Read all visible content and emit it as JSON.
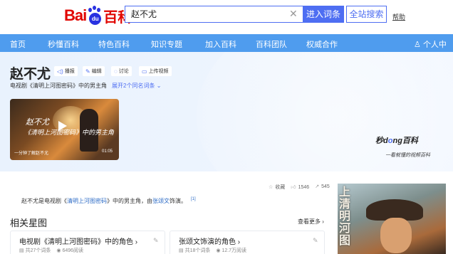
{
  "header": {
    "logo_bai": "Bai",
    "logo_du": "du",
    "logo_baike": "百科",
    "search_value": "赵不尤",
    "clear_icon": "close-icon",
    "enter_button": "进入词条",
    "site_search_button": "全站搜索",
    "help_link": "帮助",
    "accent_color": "#4e6ef2"
  },
  "nav": {
    "items": [
      "首页",
      "秒懂百科",
      "特色百科",
      "知识专题",
      "加入百科",
      "百科团队",
      "权威合作"
    ],
    "user_center": "个人中心",
    "color": "#4f9cee"
  },
  "entry": {
    "title": "赵不尤",
    "actions": [
      {
        "icon": "broadcast-icon",
        "label": "播报"
      },
      {
        "icon": "edit-icon",
        "label": "编辑"
      },
      {
        "icon": "comment-icon",
        "label": "讨论"
      },
      {
        "icon": "upload-video-icon",
        "label": "上传视频"
      }
    ],
    "subtitle": "电视剧《清明上河图密码》中的男主角",
    "more_entries": "展开2个同名词条"
  },
  "video": {
    "name": "赵不尤",
    "caption": "《清明上河图密码》中的男主角",
    "footer": "一分钟了解赵不尤",
    "duration": "01:05"
  },
  "brand": {
    "name_pre": "秒d",
    "name_o": "o",
    "name_post": "ng百科",
    "slogan": "一看就懂的视频百科"
  },
  "stats": {
    "collect": "收藏",
    "likes": "1546",
    "shares": "545"
  },
  "summary": {
    "prefix": "赵不尤是电视剧《",
    "drama_link": "清明上河图密码",
    "middle": "》中的男主角，由",
    "actor_link": "张颂文",
    "suffix": "饰演。",
    "ref": "[1]"
  },
  "related": {
    "title": "相关星图",
    "see_more": "查看更多",
    "cards": [
      {
        "title": "电视剧《清明上河图密码》中的角色",
        "entries": "共27个词条",
        "reads": "6496阅读"
      },
      {
        "title": "张颂文饰演的角色",
        "entries": "共18个词条",
        "reads": "12.7万阅读"
      }
    ]
  },
  "poster": {
    "text": "上清明河图"
  }
}
